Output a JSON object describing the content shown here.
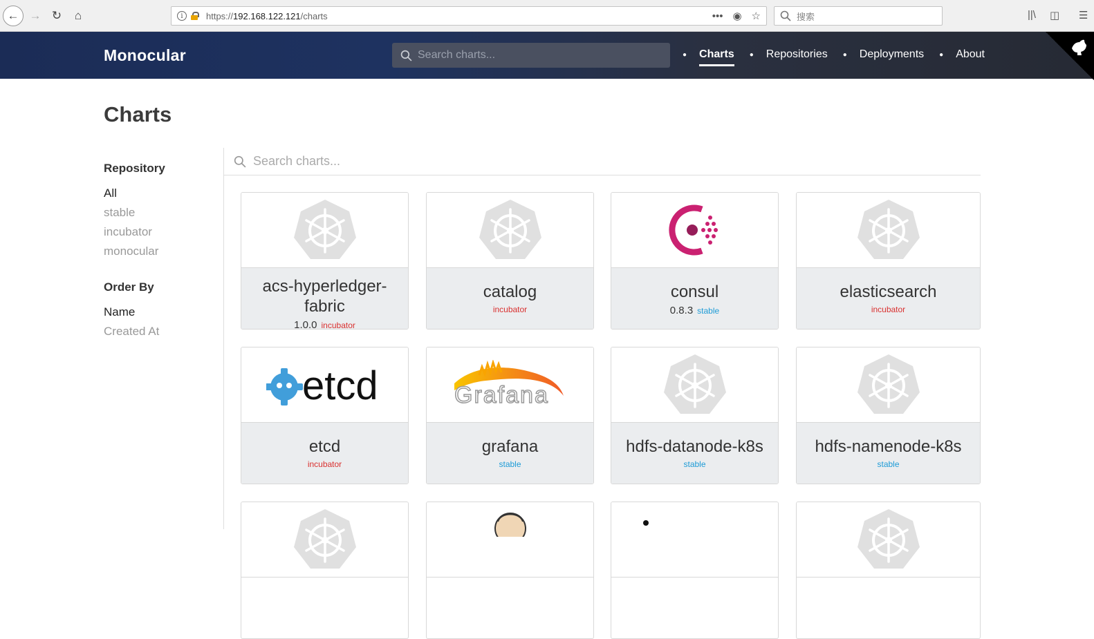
{
  "browser": {
    "url_prefix": "https://",
    "url_host": "192.168.122.121",
    "url_path": "/charts",
    "search_placeholder": "搜索"
  },
  "header": {
    "brand": "Monocular",
    "search_placeholder": "Search charts...",
    "nav": [
      {
        "label": "Charts",
        "active": true
      },
      {
        "label": "Repositories",
        "active": false
      },
      {
        "label": "Deployments",
        "active": false
      },
      {
        "label": "About",
        "active": false
      }
    ]
  },
  "page": {
    "title": "Charts",
    "search_placeholder": "Search charts..."
  },
  "sidebar": {
    "repository_title": "Repository",
    "repositories": [
      "All",
      "stable",
      "incubator",
      "monocular"
    ],
    "order_title": "Order By",
    "orders": [
      "Name",
      "Created At"
    ]
  },
  "charts": [
    {
      "name": "acs-hyperledger-fabric",
      "version": "1.0.0",
      "repo": "incubator",
      "icon": "kubernetes-icon"
    },
    {
      "name": "catalog",
      "version": "",
      "repo": "incubator",
      "icon": "kubernetes-icon"
    },
    {
      "name": "consul",
      "version": "0.8.3",
      "repo": "stable",
      "icon": "consul-icon"
    },
    {
      "name": "elasticsearch",
      "version": "",
      "repo": "incubator",
      "icon": "kubernetes-icon"
    },
    {
      "name": "etcd",
      "version": "",
      "repo": "incubator",
      "icon": "etcd-logo"
    },
    {
      "name": "grafana",
      "version": "",
      "repo": "stable",
      "icon": "grafana-logo"
    },
    {
      "name": "hdfs-datanode-k8s",
      "version": "",
      "repo": "stable",
      "icon": "kubernetes-icon"
    },
    {
      "name": "hdfs-namenode-k8s",
      "version": "",
      "repo": "stable",
      "icon": "kubernetes-icon"
    }
  ],
  "logo_text": {
    "etcd": "etcd",
    "grafana": "Grafana"
  },
  "colors": {
    "incubator": "#d9302f",
    "stable": "#1d9bd6",
    "header_start": "#1b2c56",
    "consul": "#ca2171"
  }
}
